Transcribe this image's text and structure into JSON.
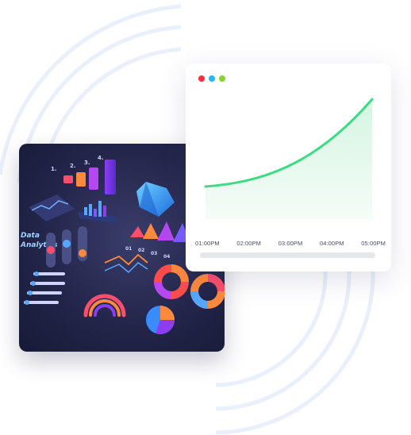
{
  "window": {
    "controls": [
      {
        "name": "close",
        "color": "#ff2f3b"
      },
      {
        "name": "minimize",
        "color": "#2bb6f6"
      },
      {
        "name": "maximize",
        "color": "#8ad233"
      }
    ]
  },
  "chart_data": {
    "type": "area",
    "x": [
      "01:00PM",
      "02:00PM",
      "03:00PM",
      "04:00PM",
      "05:00PM"
    ],
    "trend": "exponential increase",
    "line_color": "#3ddc84",
    "fill_color": "#e3f8ec",
    "grid": false
  },
  "illustration": {
    "label_line1": "Data",
    "label_line2": "Analytics",
    "ranks": [
      "1.",
      "2.",
      "3.",
      "4."
    ],
    "codes": [
      "01",
      "02",
      "03",
      "04"
    ]
  },
  "background": {
    "ring_color": "#e9f0fb"
  }
}
